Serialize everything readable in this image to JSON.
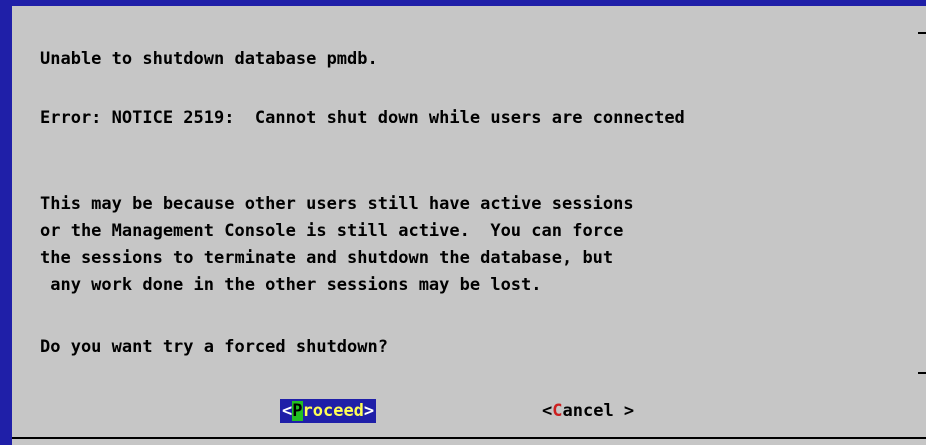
{
  "dialog": {
    "title_line": "Unable to shutdown database pmdb.",
    "error_line": "Error: NOTICE 2519:  Cannot shut down while users are connected",
    "message_lines": [
      "This may be because other users still have active sessions",
      "or the Management Console is still active.  You can force",
      "the sessions to terminate and shutdown the database, but",
      " any work done in the other sessions may be lost."
    ],
    "question": "Do you want try a forced shutdown?"
  },
  "buttons": {
    "proceed": {
      "open": "<",
      "hotkey": "P",
      "rest": "roceed",
      "close": ">"
    },
    "cancel": {
      "open": "<",
      "hotkey": "C",
      "rest": "ancel",
      "close": " >"
    }
  },
  "colors": {
    "background": "#1f1fa8",
    "dialog": "#c6c6c6",
    "hotkey_selected": "#22c022",
    "hotkey": "#cc1f1f",
    "selected_text": "#ffff55"
  }
}
